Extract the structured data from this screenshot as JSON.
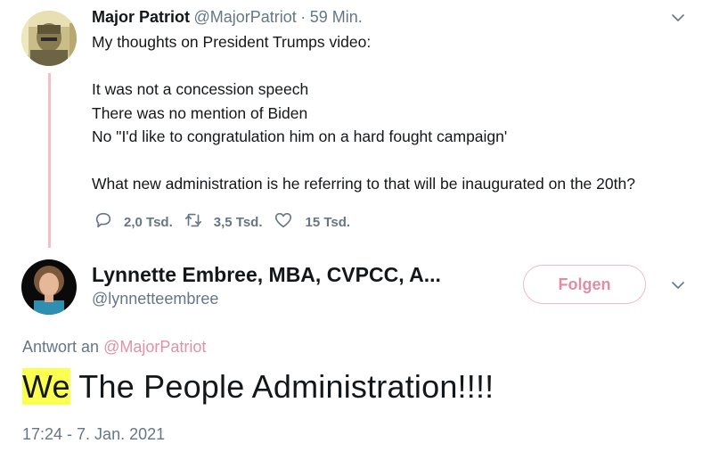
{
  "parent_tweet": {
    "display_name": "Major Patriot",
    "handle": "@MajorPatriot",
    "separator": "·",
    "time": "59 Min.",
    "lines": [
      "My thoughts on President Trumps video:",
      "It was not a concession speech",
      "There was no mention of Biden",
      "No \"I'd like to congratulation him on a hard fought campaign'",
      "What new administration is he referring to that will be inaugurated on the 20th?"
    ],
    "stats": {
      "replies": "2,0 Tsd.",
      "retweets": "3,5 Tsd.",
      "likes": "15 Tsd."
    }
  },
  "reply_tweet": {
    "display_name": "Lynnette Embree, MBA, CVPCC, A...",
    "handle": "@lynnetteembree",
    "follow_label": "Folgen",
    "replying_prefix": "Antwort an",
    "replying_to": "@MajorPatriot",
    "text_highlight": "We",
    "text_rest": " The People Administration!!!!",
    "timestamp": "17:24 - 7. Jan. 2021"
  },
  "colors": {
    "accent_pink": "#e091a6",
    "thread_line": "#f2c0cc",
    "muted": "#657786",
    "highlight": "#fbff4f"
  },
  "icons": [
    "chevron-down-icon",
    "reply-icon",
    "retweet-icon",
    "like-icon"
  ]
}
